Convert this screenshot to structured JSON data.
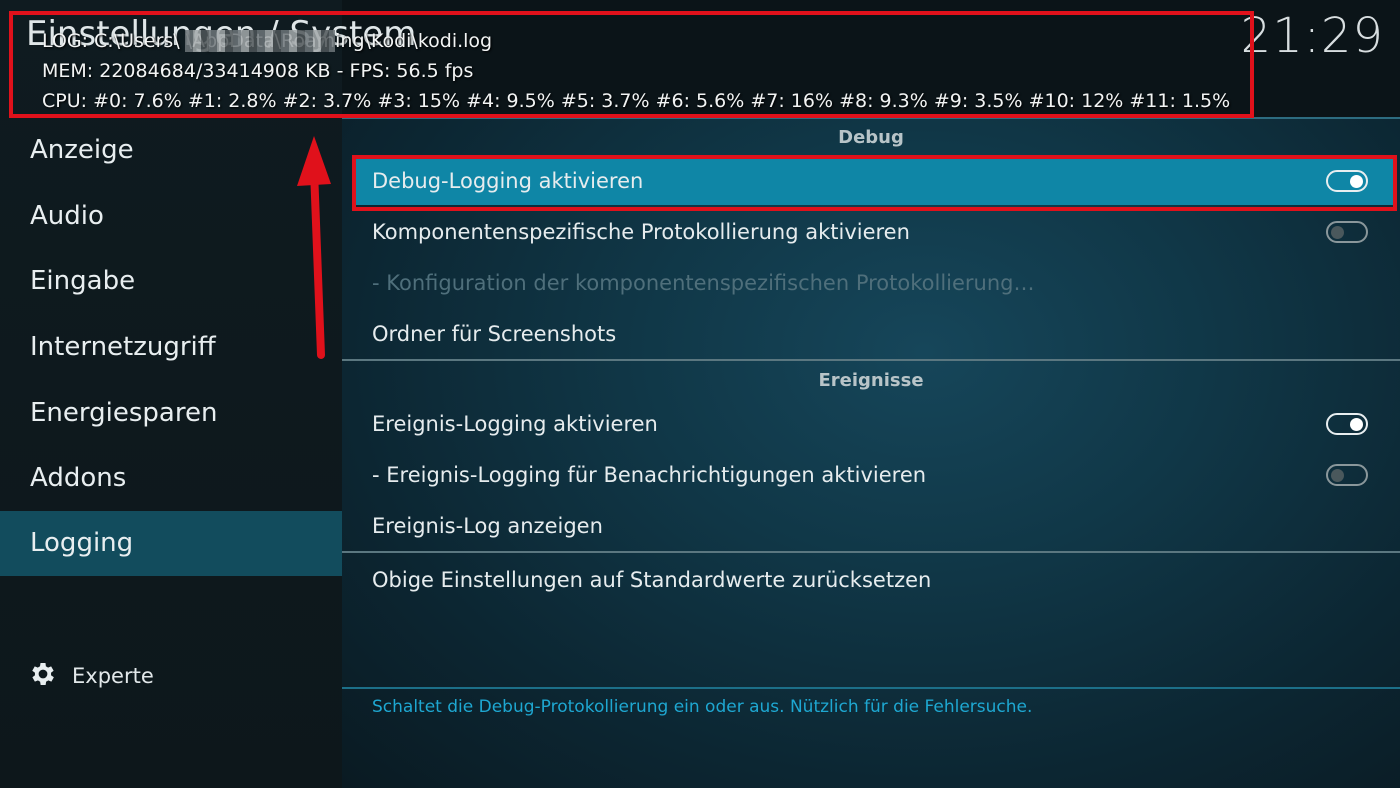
{
  "header": {
    "title": "Einstellungen / System",
    "clock": "21:29"
  },
  "debug_overlay": {
    "log_line": "LOG: C:\\Users\\          \\AppData\\Roaming\\Kodi\\kodi.log",
    "mem_line": "MEM: 22084684/33414908 KB - FPS: 56.5 fps",
    "cpu_line": "CPU: #0: 7.6% #1: 2.8% #2: 3.7% #3:  15% #4: 9.5% #5: 3.7% #6: 5.6% #7:  16% #8: 9.3% #9: 3.5% #10:  12% #11: 1.5%"
  },
  "sidebar": {
    "items": [
      {
        "label": "Anzeige"
      },
      {
        "label": "Audio"
      },
      {
        "label": "Eingabe"
      },
      {
        "label": "Internetzugriff"
      },
      {
        "label": "Energiesparen"
      },
      {
        "label": "Addons"
      },
      {
        "label": "Logging",
        "active": true
      }
    ],
    "level": {
      "label": "Experte",
      "icon": "gear-icon"
    }
  },
  "sections": {
    "debug": {
      "header": "Debug",
      "rows": [
        {
          "label": "Debug-Logging aktivieren",
          "toggle": "on",
          "focused": true
        },
        {
          "label": "Komponentenspezifische Protokollierung aktivieren",
          "toggle": "off"
        },
        {
          "label": "- Konfiguration der komponentenspezifischen Protokollierung…",
          "disabled": true
        },
        {
          "label": "Ordner für Screenshots"
        }
      ]
    },
    "events": {
      "header": "Ereignisse",
      "rows": [
        {
          "label": "Ereignis-Logging aktivieren",
          "toggle": "on"
        },
        {
          "label": "- Ereignis-Logging für Benachrichtigungen aktivieren",
          "toggle": "off"
        },
        {
          "label": "Ereignis-Log anzeigen"
        }
      ]
    },
    "reset": {
      "label": "Obige Einstellungen auf Standardwerte zurücksetzen"
    }
  },
  "help_text": "Schaltet die Debug-Protokollierung ein oder aus. Nützlich für die Fehlersuche.",
  "colors": {
    "annotation": "#e0111b",
    "focus": "#0f86a6",
    "sidebar_active": "#124c5d",
    "help_text": "#1ea7d1"
  }
}
